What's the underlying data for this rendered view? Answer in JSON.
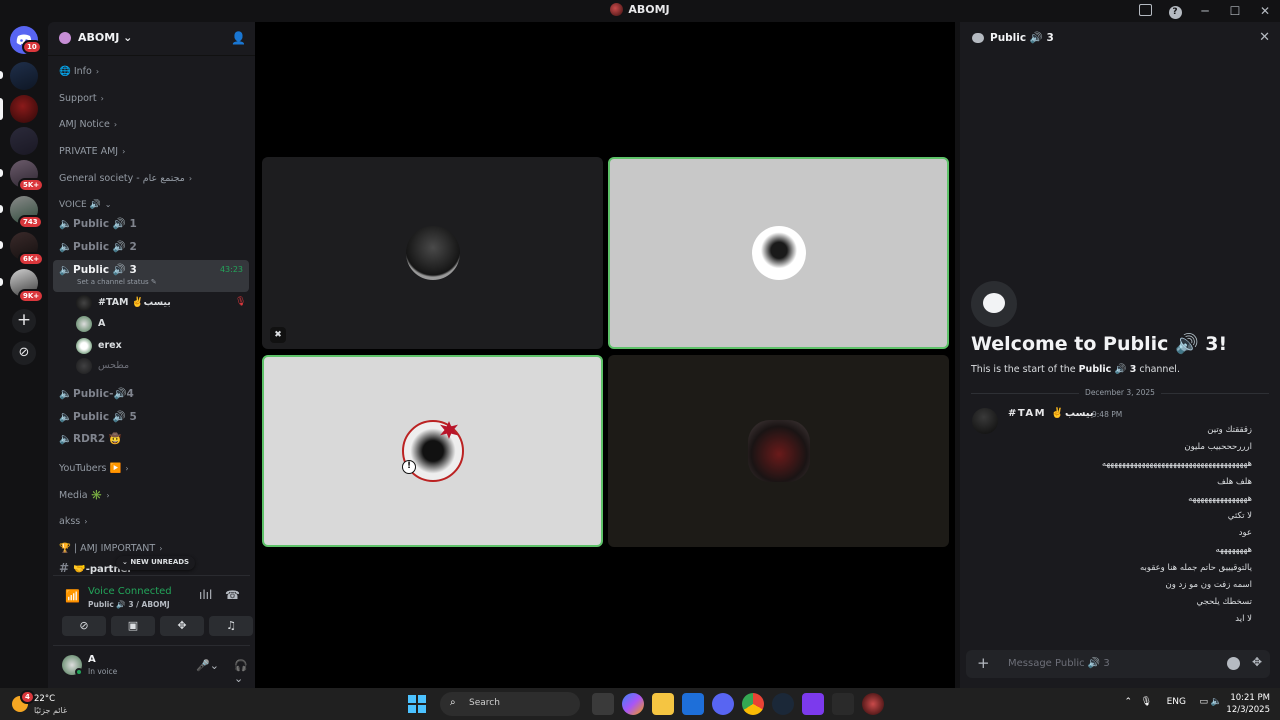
{
  "window": {
    "title": "ABOMJ"
  },
  "rail": {
    "servers": [
      {
        "badge": "10"
      },
      {
        "badge": ""
      },
      {
        "badge": ""
      },
      {
        "badge": ""
      },
      {
        "badge": "5K+"
      },
      {
        "badge": "743"
      },
      {
        "badge": "6K+"
      },
      {
        "badge": "9K+"
      }
    ]
  },
  "server": {
    "name": "ABOMJ"
  },
  "channels": {
    "info": "Info",
    "support": "Support",
    "amj_notice": "AMJ Notice",
    "private_amj": "PRIVATE AMJ",
    "general": "General society - مجتمع عام",
    "voice_category": "VOICE 🔊",
    "public1": "Public 🔊 1",
    "public2": "Public 🔊 2",
    "public3": "Public 🔊 3",
    "public3_status": "Set a channel status",
    "public3_timer": "43:23",
    "public4": "Public-🔊4",
    "public5": "Public 🔊 5",
    "rdr2": "RDR2 🤠",
    "youtubers": "YouTubers ▶️",
    "media": "Media ✳️",
    "akss": "akss",
    "important": "🏆 | AMJ IMPORTANT",
    "partner": "-partner",
    "new_unreads": "NEW UNREADS"
  },
  "members": [
    {
      "name": "#TAM ✌️بيسب"
    },
    {
      "name": "A"
    },
    {
      "name": "erex"
    },
    {
      "name": "مطحس"
    }
  ],
  "voice_panel": {
    "status": "Voice Connected",
    "channel": "Public 🔊 3 / ABOMJ"
  },
  "user": {
    "name": "A",
    "status": "In voice"
  },
  "chat": {
    "header": "Public 🔊 3",
    "welcome_title": "Welcome to Public 🔊 3!",
    "welcome_pre": "This is the start of the ",
    "welcome_channel": "Public 🔊 3",
    "welcome_post": " channel.",
    "date": "December 3, 2025",
    "message": {
      "author": "#TAM ✌️بيسب",
      "time": "9:48 PM",
      "lines": [
        "زقققتك وتين",
        "ارررحححبيب مليون",
        "هههههههههههههههههههههههههههههههههههههه",
        "هلف هلف",
        "هههههههههههههههه",
        "لا تكثي",
        "عود",
        "ههههههههه",
        "يالتوقيييق حاتم جمله هنا وعقوبه",
        "اسمه زفت ون مو زد ون",
        "تسخطك يلحجي",
        "لا ايد"
      ]
    },
    "input_placeholder": "Message Public 🔊 3"
  },
  "taskbar": {
    "weather_temp": "22°C",
    "weather_cond": "غائم جزئيًا",
    "search": "Search",
    "lang": "ENG",
    "time": "10:21 PM",
    "date": "12/3/2025"
  },
  "colors": {
    "speaking": "#5ec269",
    "online": "#23a55a",
    "mention": "#da373c"
  }
}
